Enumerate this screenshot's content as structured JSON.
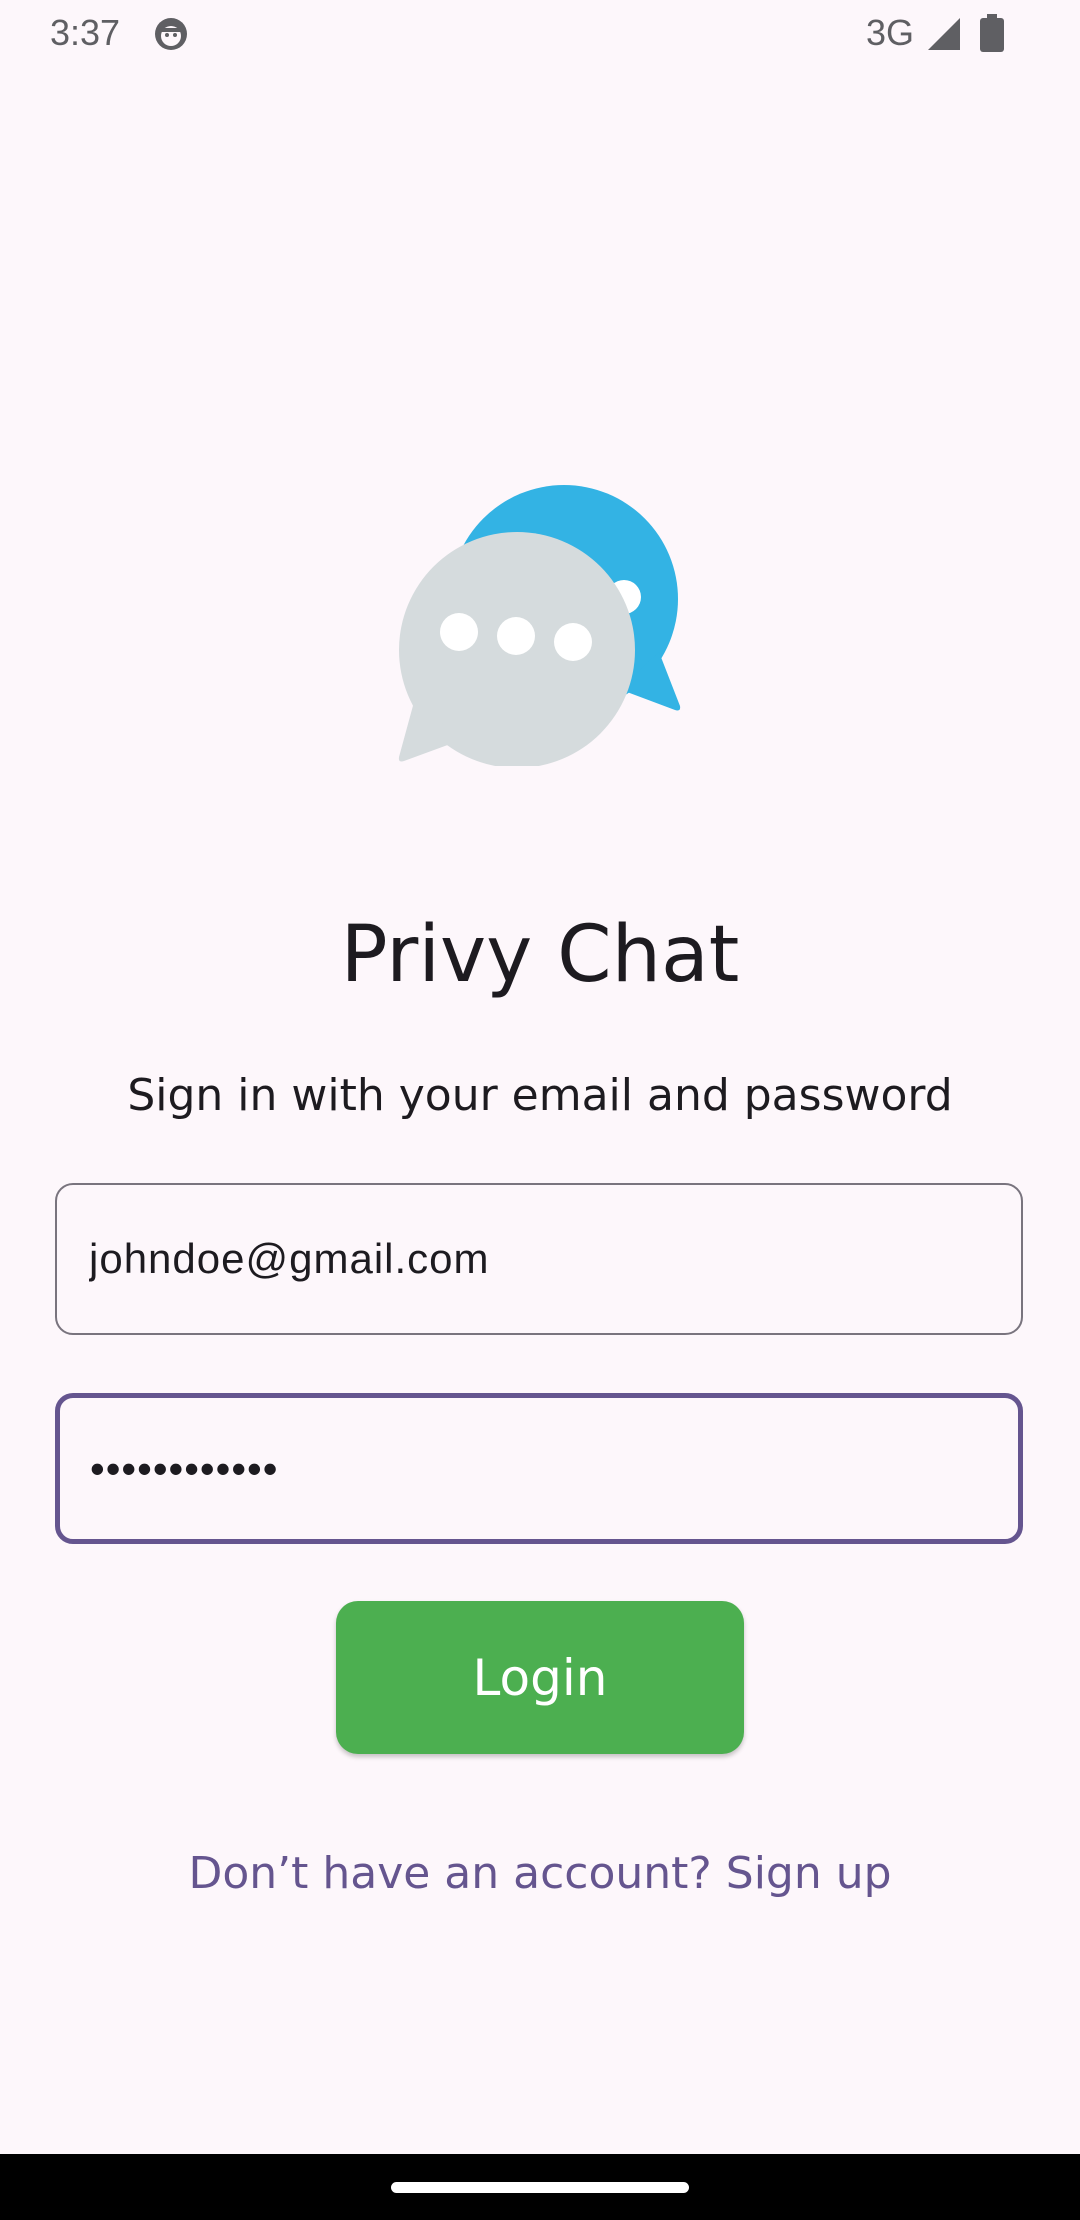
{
  "status_bar": {
    "time": "3:37",
    "network": "3G",
    "debug_icon": "android-debug-icon",
    "signal_icon": "cell-signal-icon",
    "battery_icon": "battery-icon"
  },
  "login": {
    "logo_icon": "chat-bubbles-icon",
    "title": "Privy Chat",
    "subtitle": "Sign in with your email and password",
    "email_value": "johndoe@gmail.com",
    "password_value": "••••••••••••",
    "login_button_label": "Login",
    "signup_link_label": "Don’t have an account? Sign up"
  },
  "colors": {
    "background": "#fdf7fb",
    "primary": "#65558f",
    "login_button": "#4caf50",
    "logo_blue": "#33b3e4",
    "logo_gray": "#d5dbdd"
  }
}
